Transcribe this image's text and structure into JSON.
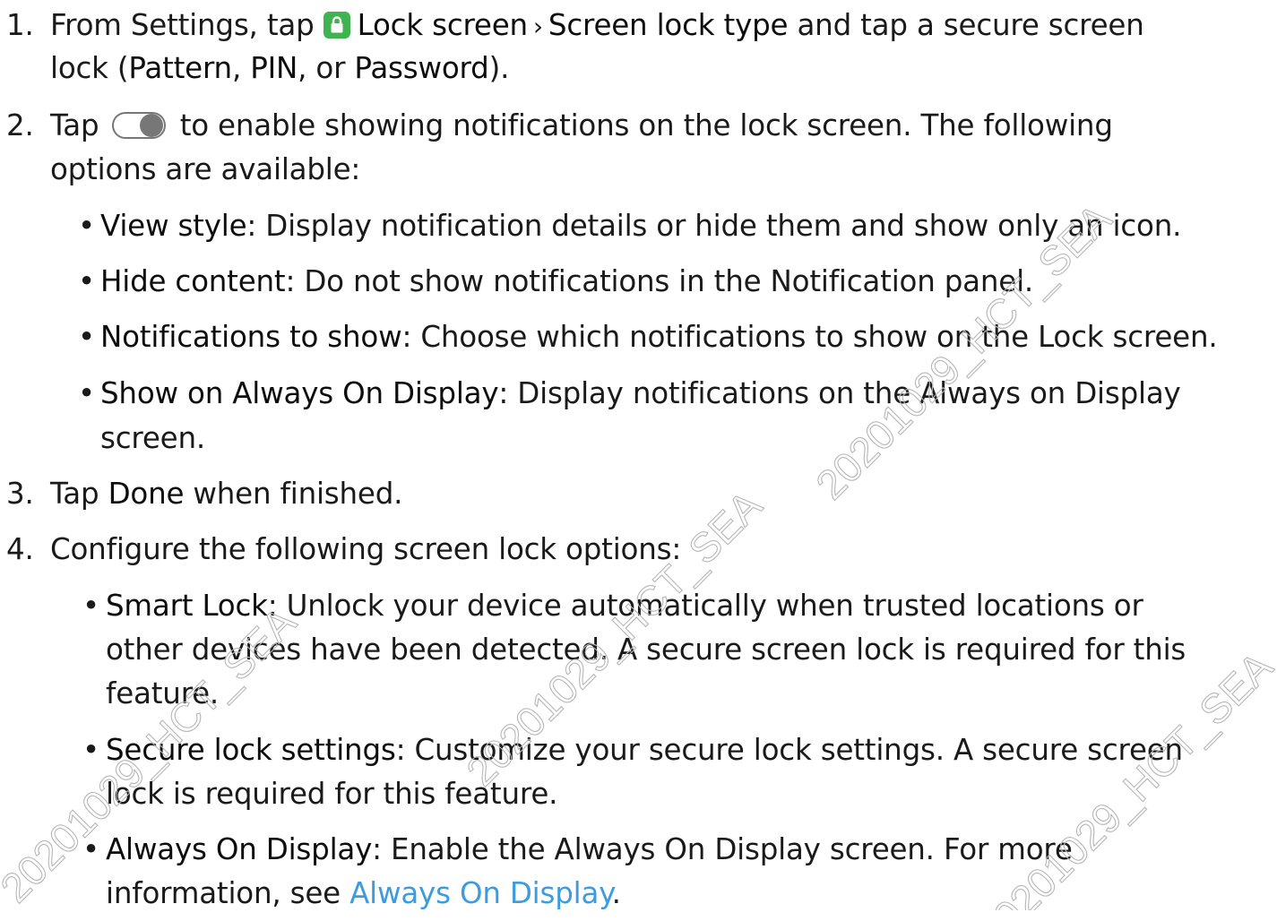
{
  "steps": [
    {
      "number": "1.",
      "line1": {
        "pre": "From Settings, tap ",
        "b1": "Lock screen",
        "b2": "Screen lock type",
        "post": " and tap a secure screen"
      },
      "line2": {
        "pre": "lock (",
        "b1": "Pattern",
        "mid1": ", ",
        "b2": "PIN",
        "mid2": ", or ",
        "b3": "Password",
        "post": ")."
      },
      "icon": "lock-icon"
    },
    {
      "number": "2.",
      "line1": {
        "pre": "Tap ",
        "post": " to enable showing notifications on the lock screen. The following"
      },
      "line2": "options are available:",
      "icon": "toggle-icon",
      "bullets": [
        {
          "term": "View style",
          "text": ": Display notification details or hide them and show only an icon."
        },
        {
          "term": "Hide content",
          "text": ": Do not show notifications in the Notification panel."
        },
        {
          "term": "Notifications to show",
          "text": ": Choose which notifications to show on the Lock screen."
        },
        {
          "term": "Show on Always On Display",
          "text": ": Display notifications on the Always on Display",
          "cont": "screen."
        }
      ]
    },
    {
      "number": "3.",
      "pre": "Tap ",
      "b1": "Done",
      "post": " when finished."
    },
    {
      "number": "4.",
      "text": "Configure the following screen lock options:",
      "bullets": [
        {
          "term": "Smart Lock",
          "text": ": Unlock your device automatically when trusted locations or",
          "cont1": "other devices have been detected. A secure screen lock is required for this",
          "cont2": "feature."
        },
        {
          "term": "Secure lock settings",
          "text": ": Customize your secure lock settings. A secure screen",
          "cont1": "lock is required for this feature."
        },
        {
          "term": "Always On Display",
          "text": ": Enable the Always On Display screen. For more",
          "cont_pre": "information, see ",
          "link": "Always On Display",
          "cont_post": "."
        }
      ]
    }
  ],
  "bullet_char": "•",
  "chevron": "›",
  "watermark": "20201029_HCT_SEA",
  "colors": {
    "text": "#1a1a1a",
    "link": "#3d9be0",
    "lock_icon_bg": "#3fb34f",
    "watermark": "#b7b7b7"
  }
}
